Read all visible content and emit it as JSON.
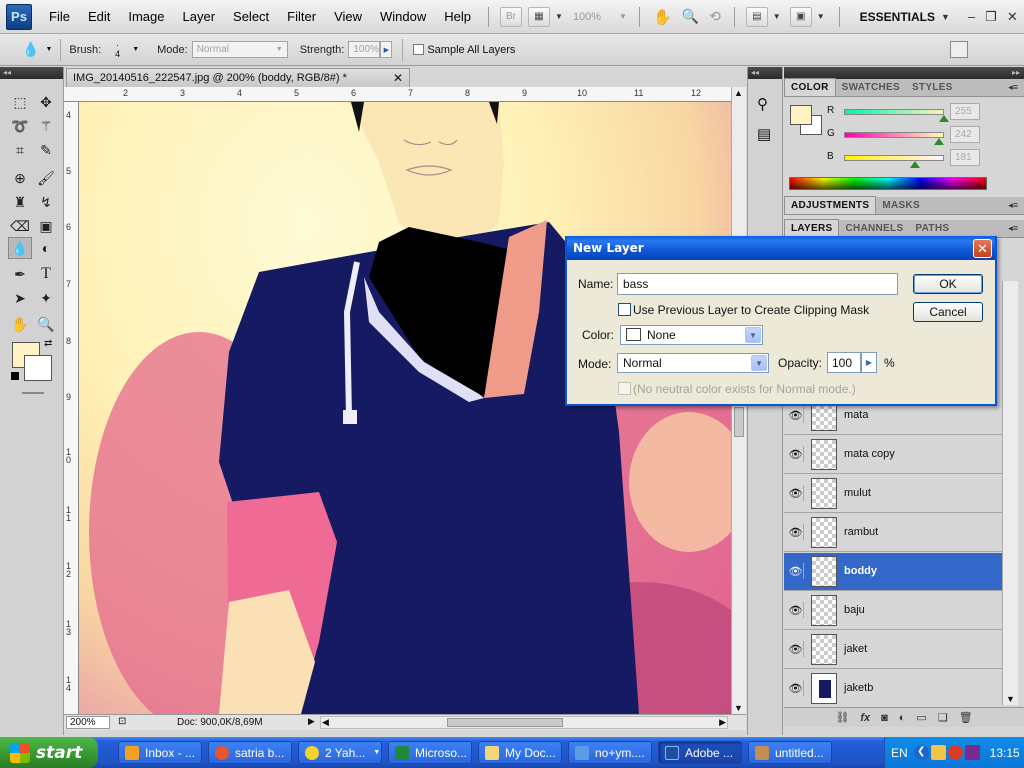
{
  "menubar": {
    "logo": "Ps",
    "items": [
      "File",
      "Edit",
      "Image",
      "Layer",
      "Select",
      "Filter",
      "View",
      "Window",
      "Help"
    ],
    "bridge_label": "Br",
    "zoom": "100%",
    "workspace": "ESSENTIALS"
  },
  "options": {
    "brush_label": "Brush:",
    "brush_size": "4",
    "mode_label": "Mode:",
    "mode_value": "Normal",
    "strength_label": "Strength:",
    "strength_value": "100%",
    "sample_all_label": "Sample All Layers"
  },
  "document": {
    "tab_title": "IMG_20140516_222547.jpg @ 200% (boddy, RGB/8#) *",
    "ruler_top": [
      "2",
      "3",
      "4",
      "5",
      "6",
      "7",
      "8",
      "9",
      "10",
      "11",
      "12"
    ],
    "ruler_left": [
      "4",
      "5",
      "6",
      "7",
      "8",
      "9",
      "1 0",
      "1 1",
      "1 2",
      "1 3",
      "1 4"
    ],
    "zoom_field": "200%",
    "doc_info": "Doc: 900,0K/8,69M"
  },
  "color_panel": {
    "tabs": [
      "COLOR",
      "SWATCHES",
      "STYLES"
    ],
    "foreground": "#fff3c6",
    "r": {
      "label": "R",
      "value": "255"
    },
    "g": {
      "label": "G",
      "value": "242"
    },
    "b": {
      "label": "B",
      "value": "181"
    }
  },
  "adjust_panel": {
    "tabs": [
      "ADJUSTMENTS",
      "MASKS"
    ]
  },
  "layers_panel": {
    "tabs": [
      "LAYERS",
      "CHANNELS",
      "PATHS"
    ],
    "layers": [
      {
        "name": "mata",
        "selected": false
      },
      {
        "name": "mata copy",
        "selected": false
      },
      {
        "name": "mulut",
        "selected": false
      },
      {
        "name": "rambut",
        "selected": false
      },
      {
        "name": "boddy",
        "selected": true
      },
      {
        "name": "baju",
        "selected": false
      },
      {
        "name": "jaket",
        "selected": false
      },
      {
        "name": "jaketb",
        "selected": false
      }
    ],
    "footer_icons": [
      "link-icon",
      "fx-icon",
      "mask-icon",
      "adjustment-icon",
      "group-icon",
      "new-layer-icon",
      "trash-icon"
    ]
  },
  "dialog": {
    "title": "New Layer",
    "name_label": "Name:",
    "name_value": "bass",
    "clipping_label": "Use Previous Layer to Create Clipping Mask",
    "color_label": "Color:",
    "color_value": "None",
    "mode_label": "Mode:",
    "mode_value": "Normal",
    "opacity_label": "Opacity:",
    "opacity_value": "100",
    "opacity_unit": "%",
    "neutral_label": "(No neutral color exists for Normal mode.)",
    "ok_label": "OK",
    "cancel_label": "Cancel"
  },
  "taskbar": {
    "start_label": "start",
    "tasks": [
      {
        "label": "Inbox - ...",
        "color": "#f4a020"
      },
      {
        "label": "satria b...",
        "color": "#e8562c"
      },
      {
        "label": "2 Yah...",
        "color": "#f6d32c"
      },
      {
        "label": "Microso...",
        "color": "#1f8a3c"
      },
      {
        "label": "My Doc...",
        "color": "#f1d67a"
      },
      {
        "label": "no+ym....",
        "color": "#5b9be8"
      },
      {
        "label": "Adobe ...",
        "color": "#1c4fa0"
      },
      {
        "label": "untitled...",
        "color": "#c38d54"
      }
    ],
    "lang": "EN",
    "clock": "13:15"
  }
}
